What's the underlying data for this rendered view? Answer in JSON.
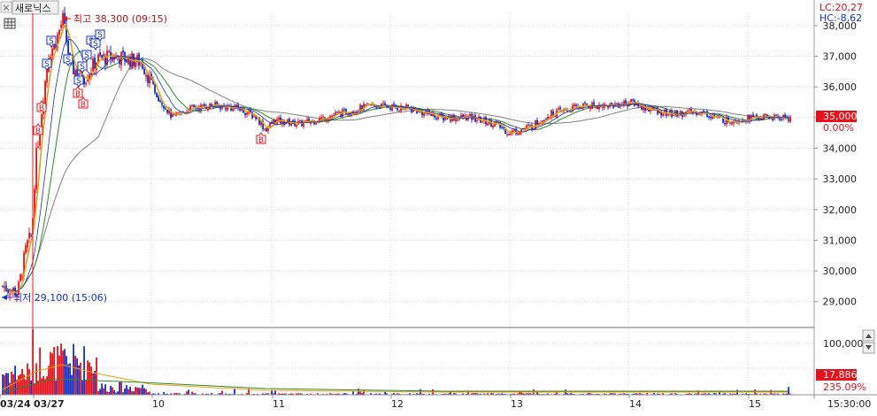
{
  "stock_name": "새로닉스",
  "toolbar": {
    "close_glyph": "×",
    "menu_icon": "table-grid-icon"
  },
  "indicators": {
    "lc": "LC:20,27",
    "hc": "HC:-8,62"
  },
  "annotations": {
    "high": "최고 38,300 (09:15)",
    "low": "최저 29,100 (15:06)"
  },
  "current_price": {
    "value": "35,000",
    "change": "0.00%"
  },
  "current_volume": {
    "value": "17,886",
    "change": "235.09%"
  },
  "price_axis": [
    "38,000",
    "37,000",
    "36,000",
    "35,000",
    "34,000",
    "33,000",
    "32,000",
    "31,000",
    "30,000",
    "29,000"
  ],
  "volume_axis": [
    "100,000"
  ],
  "time_labels": [
    "03/24",
    "03/27",
    "10",
    "11",
    "12",
    "13",
    "14",
    "15",
    "15:30:00"
  ],
  "signals": {
    "sell": "S",
    "buy": "B"
  },
  "colors": {
    "up": "#e8101a",
    "down": "#1030c8",
    "ma5": "#e8a010",
    "ma20": "#2a8a2a",
    "ma60": "#808080",
    "grid": "#d8d8d8"
  },
  "chart_data": {
    "type": "candlestick",
    "price_ticks": [
      38000,
      37000,
      36000,
      35000,
      34000,
      33000,
      32000,
      31000,
      30000,
      29000
    ],
    "ylim": [
      28300,
      38400
    ],
    "volume_ylim": [
      0,
      150000
    ],
    "series": [
      {
        "name": "close",
        "x": [
          "03/24 09:05",
          "03/24 15:06",
          "03/27 09:15",
          "03/27 15:30",
          "10 10:30",
          "10 15:30",
          "11 09:30",
          "11 15:30",
          "12 09:30",
          "12 15:30",
          "13 09:30",
          "13 15:30",
          "14 09:30",
          "14 15:30",
          "15 09:30",
          "15 15:30"
        ],
        "values": [
          29500,
          29100,
          38300,
          37000,
          35300,
          35300,
          34700,
          35000,
          35400,
          35200,
          34500,
          35100,
          35600,
          35100,
          34900,
          35000
        ]
      }
    ],
    "high": 38300,
    "low": 29100,
    "current": 35000
  }
}
